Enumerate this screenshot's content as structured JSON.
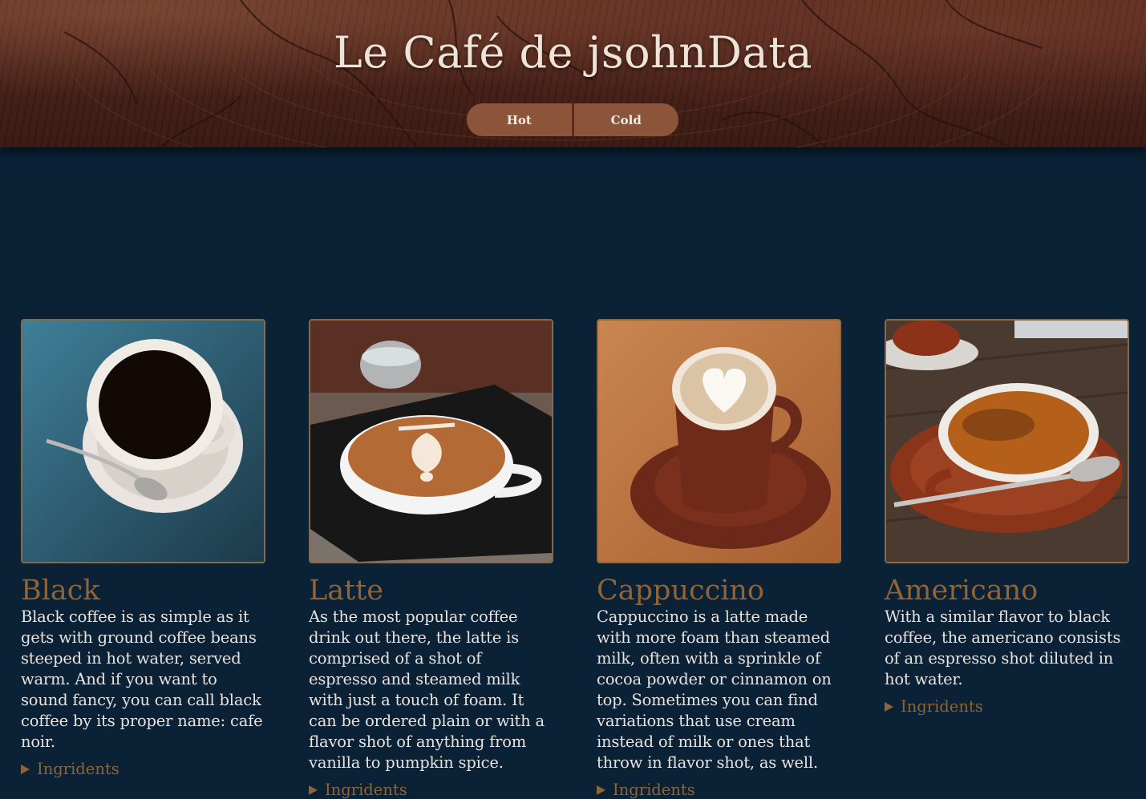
{
  "header": {
    "title": "Le Café de jsohnData",
    "tabs": [
      {
        "label": "Hot"
      },
      {
        "label": "Cold"
      }
    ]
  },
  "cards": [
    {
      "name": "Black",
      "description": "Black coffee is as simple as it gets with ground coffee beans steeped in hot water, served warm. And if you want to sound fancy, you can call black coffee by its proper name: cafe noir.",
      "details_label": "Ingridents"
    },
    {
      "name": "Latte",
      "description": "As the most popular coffee drink out there, the latte is comprised of a shot of espresso and steamed milk with just a touch of foam. It can be ordered plain or with a flavor shot of anything from vanilla to pumpkin spice.",
      "details_label": "Ingridents"
    },
    {
      "name": "Cappuccino",
      "description": "Cappuccino is a latte made with more foam than steamed milk, often with a sprinkle of cocoa powder or cinnamon on top. Sometimes you can find variations that use cream instead of milk or ones that throw in flavor shot, as well.",
      "details_label": "Ingridents"
    },
    {
      "name": "Americano",
      "description": "With a similar flavor to black coffee, the americano consists of an espresso shot diluted in hot water.",
      "details_label": "Ingridents"
    }
  ],
  "colors": {
    "background": "#0a2136",
    "accent": "#8f6437",
    "tab": "#8c5438",
    "text": "#e8e3de"
  }
}
